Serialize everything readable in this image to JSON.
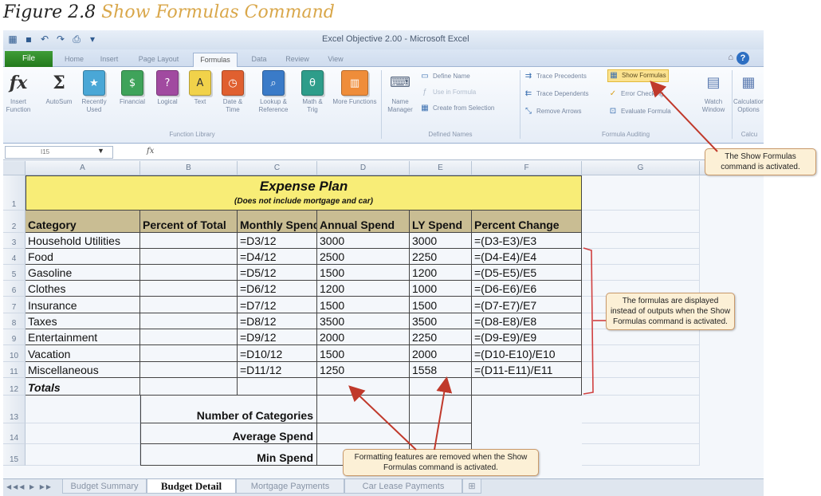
{
  "caption": {
    "prefix": "Figure 2.8",
    "title": "Show Formulas Command"
  },
  "window": {
    "title": "Excel Objective 2.00 - Microsoft Excel",
    "file_tab": "File",
    "tabs": [
      "Home",
      "Insert",
      "Page Layout",
      "Formulas",
      "Data",
      "Review",
      "View"
    ],
    "active_tab": "Formulas"
  },
  "ribbon": {
    "function_library": {
      "label": "Function Library",
      "buttons": [
        {
          "label": "Insert Function"
        },
        {
          "label": "AutoSum"
        },
        {
          "label": "Recently Used"
        },
        {
          "label": "Financial"
        },
        {
          "label": "Logical"
        },
        {
          "label": "Text"
        },
        {
          "label": "Date & Time"
        },
        {
          "label": "Lookup & Reference"
        },
        {
          "label": "Math & Trig"
        },
        {
          "label": "More Functions"
        }
      ]
    },
    "defined_names": {
      "label": "Defined Names",
      "name_manager": "Name Manager",
      "define_name": "Define Name",
      "use_in_formula": "Use in Formula",
      "create_from_selection": "Create from Selection"
    },
    "formula_auditing": {
      "label": "Formula Auditing",
      "trace_precedents": "Trace Precedents",
      "trace_dependents": "Trace Dependents",
      "remove_arrows": "Remove Arrows",
      "show_formulas": "Show Formulas",
      "error_checking": "Error Checking",
      "evaluate_formula": "Evaluate Formula",
      "watch_window": "Watch Window"
    },
    "calculation": {
      "label": "Calcu",
      "options": "Calculation Options"
    }
  },
  "formula_bar": {
    "name_box": "I15",
    "fx": "fx"
  },
  "columns": [
    "A",
    "B",
    "C",
    "D",
    "E",
    "F",
    "G"
  ],
  "rows": [
    "1",
    "2",
    "3",
    "4",
    "5",
    "6",
    "7",
    "8",
    "9",
    "10",
    "11",
    "12",
    "13",
    "14",
    "15"
  ],
  "sheet": {
    "title": "Expense Plan",
    "subtitle": "(Does not include mortgage and car)",
    "headers": [
      "Category",
      "Percent of Total",
      "Monthly Spend",
      "Annual Spend",
      "LY Spend",
      "Percent Change"
    ],
    "data_rows": [
      [
        "Household Utilities",
        "",
        "=D3/12",
        "3000",
        "3000",
        "=(D3-E3)/E3"
      ],
      [
        "Food",
        "",
        "=D4/12",
        "2500",
        "2250",
        "=(D4-E4)/E4"
      ],
      [
        "Gasoline",
        "",
        "=D5/12",
        "1500",
        "1200",
        "=(D5-E5)/E5"
      ],
      [
        "Clothes",
        "",
        "=D6/12",
        "1200",
        "1000",
        "=(D6-E6)/E6"
      ],
      [
        "Insurance",
        "",
        "=D7/12",
        "1500",
        "1500",
        "=(D7-E7)/E7"
      ],
      [
        "Taxes",
        "",
        "=D8/12",
        "3500",
        "3500",
        "=(D8-E8)/E8"
      ],
      [
        "Entertainment",
        "",
        "=D9/12",
        "2000",
        "2250",
        "=(D9-E9)/E9"
      ],
      [
        "Vacation",
        "",
        "=D10/12",
        "1500",
        "2000",
        "=(D10-E10)/E10"
      ],
      [
        "Miscellaneous",
        "",
        "=D11/12",
        "1250",
        "1558",
        "=(D11-E11)/E11"
      ]
    ],
    "totals": "Totals",
    "summary": [
      "Number of Categories",
      "Average Spend",
      "Min Spend"
    ]
  },
  "sheet_tabs": [
    "Budget Summary",
    "Budget Detail",
    "Mortgage Payments",
    "Car Lease Payments"
  ],
  "active_sheet": "Budget Detail",
  "callouts": {
    "show_formulas": "The Show Formulas command is activated.",
    "formulas_displayed": "The formulas are displayed instead of outputs when the Show Formulas command is activated.",
    "formatting_removed": "Formatting features are removed when the Show Formulas command is activated."
  },
  "colors": {
    "title_band": "#f8ed77",
    "header_band": "#c9bd93",
    "callout_fill": "#fcf0d6",
    "arrow": "#c0392b",
    "file_tab": "#2f8a28"
  }
}
